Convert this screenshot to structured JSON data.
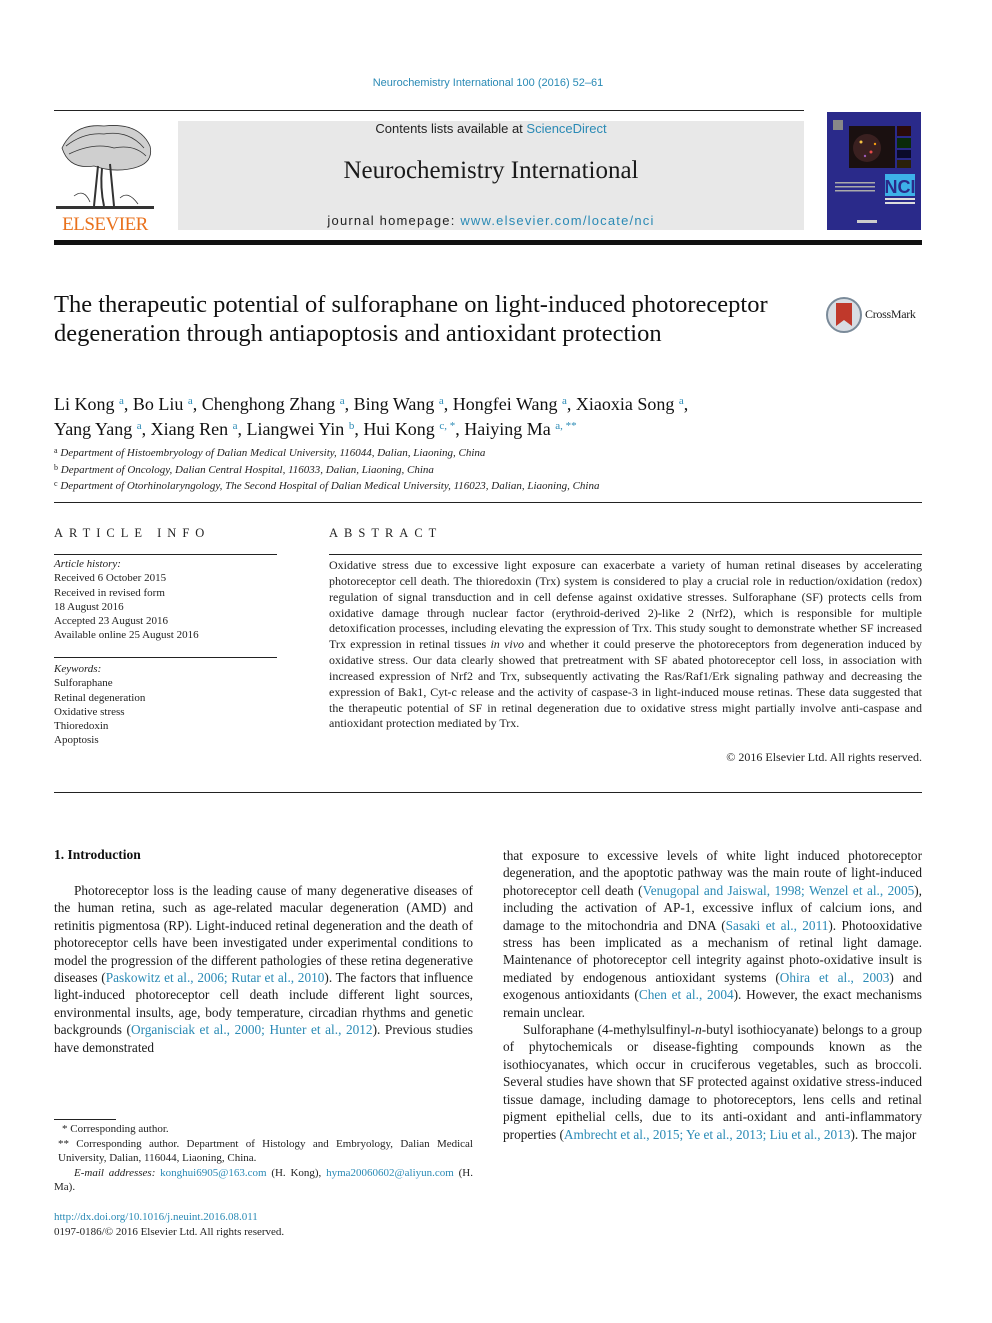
{
  "running_head": "Neurochemistry International 100 (2016) 52–61",
  "publisher": {
    "logo_word": "ELSEVIER",
    "logo_color": "#e9711c"
  },
  "masthead": {
    "contents_prefix": "Contents lists available at ",
    "contents_link": "ScienceDirect",
    "journal_name": "Neurochemistry International",
    "homepage_prefix": "journal homepage: ",
    "homepage_link": "www.elsevier.com/locate/nci"
  },
  "cover": {
    "acronym": "NCI",
    "subtitle": "NEUROCHEMISTRY INTERNATIONAL"
  },
  "crossmark": {
    "label": "CrossMark"
  },
  "article": {
    "title": "The therapeutic potential of sulforaphane on light-induced photoreceptor degeneration through antiapoptosis and antioxidant protection",
    "authors": [
      {
        "name": "Li Kong",
        "aff": "a"
      },
      {
        "name": "Bo Liu",
        "aff": "a"
      },
      {
        "name": "Chenghong Zhang",
        "aff": "a"
      },
      {
        "name": "Bing Wang",
        "aff": "a"
      },
      {
        "name": "Hongfei Wang",
        "aff": "a"
      },
      {
        "name": "Xiaoxia Song",
        "aff": "a"
      },
      {
        "name": "Yang Yang",
        "aff": "a"
      },
      {
        "name": "Xiang Ren",
        "aff": "a"
      },
      {
        "name": "Liangwei Yin",
        "aff": "b"
      },
      {
        "name": "Hui Kong",
        "aff": "c, *"
      },
      {
        "name": "Haiying Ma",
        "aff": "a, **"
      }
    ],
    "affiliations": [
      {
        "key": "a",
        "text": "Department of Histoembryology of Dalian Medical University, 116044, Dalian, Liaoning, China"
      },
      {
        "key": "b",
        "text": "Department of Oncology, Dalian Central Hospital, 116033, Dalian, Liaoning, China"
      },
      {
        "key": "c",
        "text": "Department of Otorhinolaryngology, The Second Hospital of Dalian Medical University, 116023, Dalian, Liaoning, China"
      }
    ]
  },
  "article_info": {
    "heading": "ARTICLE INFO",
    "history_label": "Article history:",
    "history": [
      "Received 6 October 2015",
      "Received in revised form",
      "18 August 2016",
      "Accepted 23 August 2016",
      "Available online 25 August 2016"
    ],
    "keywords_label": "Keywords:",
    "keywords": [
      "Sulforaphane",
      "Retinal degeneration",
      "Oxidative stress",
      "Thioredoxin",
      "Apoptosis"
    ]
  },
  "abstract": {
    "heading": "ABSTRACT",
    "part1": "Oxidative stress due to excessive light exposure can exacerbate a variety of human retinal diseases by accelerating photoreceptor cell death. The thioredoxin (Trx) system is considered to play a crucial role in reduction/oxidation (redox) regulation of signal transduction and in cell defense against oxidative stresses. Sulforaphane (SF) protects cells from oxidative damage through nuclear factor (erythroid-derived 2)-like 2 (Nrf2), which is responsible for multiple detoxification processes, including elevating the expression of Trx. This study sought to demonstrate whether SF increased Trx expression in retinal tissues ",
    "italic": "in vivo",
    "part2": " and whether it could preserve the photoreceptors from degeneration induced by oxidative stress. Our data clearly showed that pretreatment with SF abated photoreceptor cell loss, in association with increased expression of Nrf2 and Trx, subsequently activating the Ras/Raf1/Erk signaling pathway and decreasing the expression of Bak1, Cyt-c release and the activity of caspase-3 in light-induced mouse retinas. These data suggested that the therapeutic potential of SF in retinal degeneration due to oxidative stress might partially involve anti-caspase and antioxidant protection mediated by Trx.",
    "copyright": "© 2016 Elsevier Ltd. All rights reserved."
  },
  "intro": {
    "heading": "1.  Introduction",
    "left_p1_a": "Photoreceptor loss is the leading cause of many degenerative diseases of the human retina, such as age-related macular degeneration (AMD) and retinitis pigmentosa (RP). Light-induced retinal degeneration and the death of photoreceptor cells have been investigated under experimental conditions to model the progression of the different pathologies of these retina degenerative diseases (",
    "left_cite1": "Paskowitz et al., 2006; Rutar et al., 2010",
    "left_p1_b": "). The factors that influence light-induced photoreceptor cell death include different light sources, environmental insults, age, body temperature, circadian rhythms and genetic backgrounds (",
    "left_cite2": "Organisciak et al., 2000; Hunter et al., 2012",
    "left_p1_c": "). Previous studies have demonstrated",
    "right_p1_a": "that exposure to excessive levels of white light induced photoreceptor degeneration, and the apoptotic pathway was the main route of light-induced photoreceptor cell death (",
    "right_cite1": "Venugopal and Jaiswal, 1998; Wenzel et al., 2005",
    "right_p1_b": "), including the activation of AP-1, excessive influx of calcium ions, and damage to the mitochondria and DNA (",
    "right_cite2": "Sasaki et al., 2011",
    "right_p1_c": "). Photooxidative stress has been implicated as a mechanism of retinal light damage. Maintenance of photoreceptor cell integrity against photo-oxidative insult is mediated by endogenous antioxidant systems (",
    "right_cite3": "Ohira et al., 2003",
    "right_p1_d": ") and exogenous antioxidants (",
    "right_cite4": "Chen et al., 2004",
    "right_p1_e": "). However, the exact mechanisms remain unclear.",
    "right_p2_a": "Sulforaphane (4-methylsulfinyl-",
    "right_p2_italic": "n",
    "right_p2_b": "-butyl isothiocyanate) belongs to a group of phytochemicals or disease-fighting compounds known as the isothiocyanates, which occur in cruciferous vegetables, such as broccoli. Several studies have shown that SF protected against oxidative stress-induced tissue damage, including damage to photoreceptors, lens cells and retinal pigment epithelial cells, due to its anti-oxidant and anti-inflammatory properties (",
    "right_cite5": "Ambrecht et al., 2015; Ye et al., 2013; Liu et al., 2013",
    "right_p2_c": "). The major"
  },
  "footnotes": {
    "star1": "* Corresponding author.",
    "star2": "** Corresponding author. Department of Histology and Embryology, Dalian Medical University, Dalian, 116044, Liaoning, China.",
    "email_label": "E-mail addresses:",
    "email1": "konghui6905@163.com",
    "email1_owner": " (H. Kong), ",
    "email2": "hyma20060602@aliyun.com",
    "email2_owner": " (H. Ma)."
  },
  "doi": {
    "link": "http://dx.doi.org/10.1016/j.neuint.2016.08.011",
    "issn_line": "0197-0186/© 2016 Elsevier Ltd. All rights reserved."
  },
  "colors": {
    "link": "#2a8ab5",
    "masthead_bg": "#e8e8e8",
    "cover_bg": "#2a2a8a",
    "crossmark_red": "#c0392b"
  }
}
